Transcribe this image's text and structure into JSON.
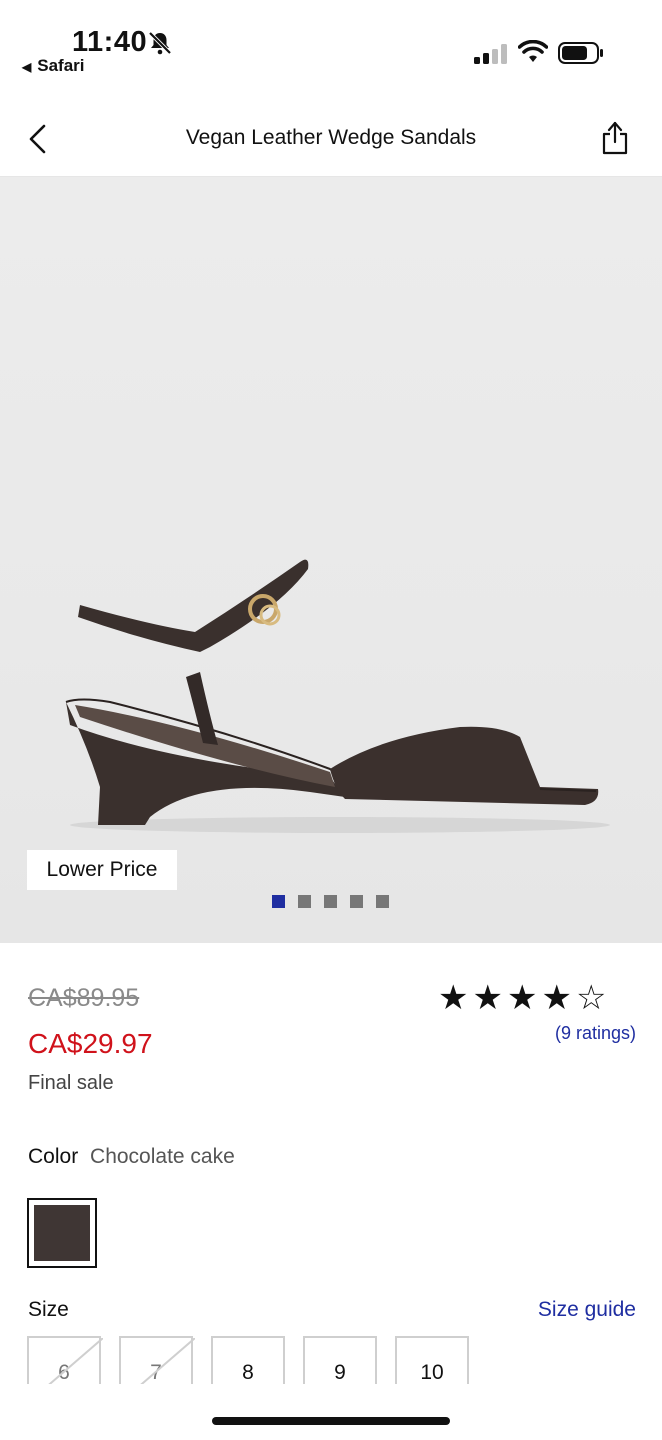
{
  "status_bar": {
    "time": "11:40",
    "back_app": "Safari"
  },
  "nav": {
    "title": "Vegan Leather Wedge Sandals"
  },
  "hero": {
    "badge": "Lower Price",
    "slide_count": 5,
    "active_slide": 1
  },
  "product": {
    "original_price": "CA$89.95",
    "sale_price": "CA$29.97",
    "final_sale": "Final sale",
    "rating_stars": 4,
    "rating_max": 5,
    "ratings_text": "(9 ratings)"
  },
  "color": {
    "label": "Color",
    "value": "Chocolate cake",
    "swatch_hex": "#3f3634"
  },
  "size": {
    "label": "Size",
    "guide": "Size guide",
    "options": [
      {
        "label": "6",
        "available": false
      },
      {
        "label": "7",
        "available": false
      },
      {
        "label": "8",
        "available": true
      },
      {
        "label": "9",
        "available": true
      },
      {
        "label": "10",
        "available": true
      }
    ]
  },
  "colors": {
    "accent_blue": "#1f2ea1",
    "sale_red": "#d0121b"
  }
}
